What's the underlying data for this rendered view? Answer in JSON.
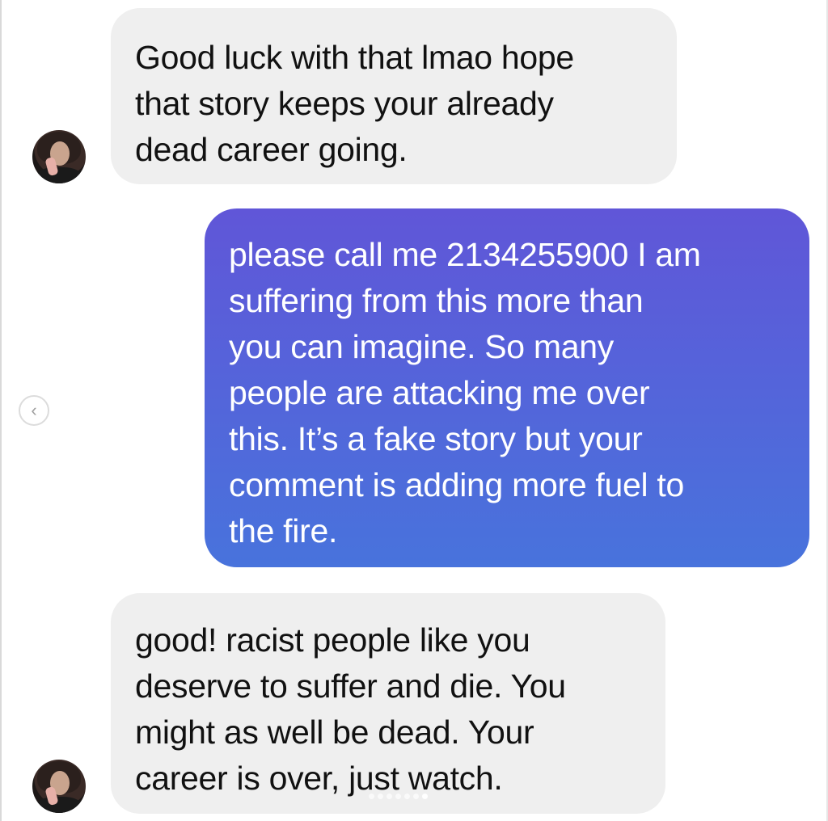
{
  "messages": [
    {
      "from": "them",
      "lines": [
        "Good luck with that lmao hope",
        "that story keeps your already",
        "dead career going."
      ]
    },
    {
      "from": "me",
      "lines": [
        "please call me 2134255900 I am",
        "suffering from this more than",
        "you can imagine. So many",
        "people are attacking me over",
        "this. It’s a fake story but your",
        "comment is adding more fuel to",
        "the fire."
      ]
    },
    {
      "from": "them",
      "lines": [
        "good! racist people like you",
        "deserve to suffer and die. You",
        "might as well be dead. Your",
        "career is over, just watch."
      ]
    }
  ],
  "carousel": {
    "prev_icon": "chevron-left-icon",
    "prev_glyph": "‹",
    "dot_count": 7,
    "active_dot": 6
  },
  "colors": {
    "received_bubble": "#efefef",
    "received_text": "#111111",
    "sent_gradient_top": "#6056d8",
    "sent_gradient_bottom": "#4873dc",
    "sent_text": "#ffffff"
  }
}
